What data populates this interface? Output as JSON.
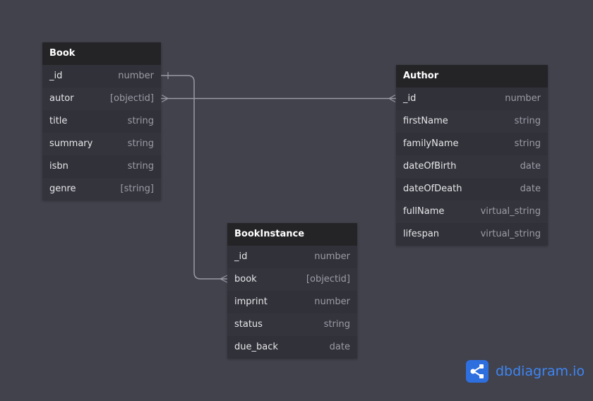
{
  "tables": {
    "book": {
      "name": "Book",
      "fields": [
        {
          "name": "_id",
          "type": "number"
        },
        {
          "name": "autor",
          "type": "[objectid]"
        },
        {
          "name": "title",
          "type": "string"
        },
        {
          "name": "summary",
          "type": "string"
        },
        {
          "name": "isbn",
          "type": "string"
        },
        {
          "name": "genre",
          "type": "[string]"
        }
      ]
    },
    "author": {
      "name": "Author",
      "fields": [
        {
          "name": "_id",
          "type": "number"
        },
        {
          "name": "firstName",
          "type": "string"
        },
        {
          "name": "familyName",
          "type": "string"
        },
        {
          "name": "dateOfBirth",
          "type": "date"
        },
        {
          "name": "dateOfDeath",
          "type": "date"
        },
        {
          "name": "fullName",
          "type": "virtual_string"
        },
        {
          "name": "lifespan",
          "type": "virtual_string"
        }
      ]
    },
    "bookinstance": {
      "name": "BookInstance",
      "fields": [
        {
          "name": "_id",
          "type": "number"
        },
        {
          "name": "book",
          "type": "[objectid]"
        },
        {
          "name": "imprint",
          "type": "number"
        },
        {
          "name": "status",
          "type": "string"
        },
        {
          "name": "due_back",
          "type": "date"
        }
      ]
    }
  },
  "relations": [
    {
      "from": "Book._id",
      "from_cardinality": "one",
      "to": "BookInstance.book",
      "to_cardinality": "many"
    },
    {
      "from": "Book.autor",
      "from_cardinality": "many",
      "to": "Author._id",
      "to_cardinality": "many"
    }
  ],
  "branding": {
    "text_main": "dbdiagram",
    "text_suffix": ".io",
    "icon": "share-nodes-icon",
    "color": "#3d86f5"
  },
  "colors": {
    "background": "#42424c",
    "header": "#242427",
    "row": "#313139",
    "line": "#9a9aa4"
  }
}
